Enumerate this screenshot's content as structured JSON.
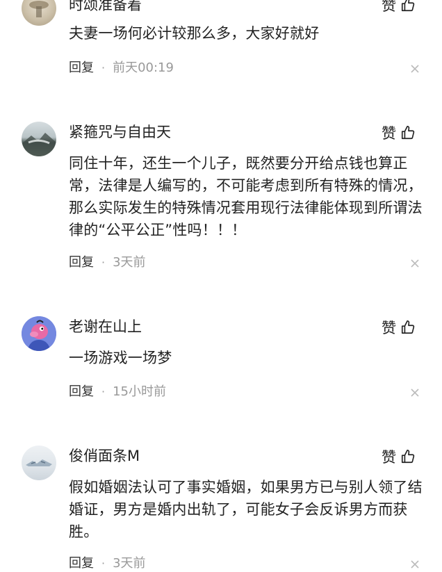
{
  "like_label": "赞",
  "reply_label": "回复",
  "comments": [
    {
      "user": "时颂准备着",
      "text": "夫妻一场何必计较那么多，大家好就好",
      "time": "前天00:19"
    },
    {
      "user": "紧箍咒与自由天",
      "text": "同住十年，还生一个儿子，既然要分开给点钱也算正常，法律是人编写的，不可能考虑到所有特殊的情况，那么实际发生的特殊情况套用现行法律能体现到所谓法律的“公平公正”性吗！！！",
      "time": "3天前"
    },
    {
      "user": "老谢在山上",
      "text": "一场游戏一场梦",
      "time": "15小时前"
    },
    {
      "user": "俊俏面条M",
      "text": "假如婚姻法认可了事实婚姻，如果男方已与别人领了结婚证，男方是婚内出轨了，可能女子会反诉男方而获胜。",
      "time": "3天前"
    }
  ]
}
